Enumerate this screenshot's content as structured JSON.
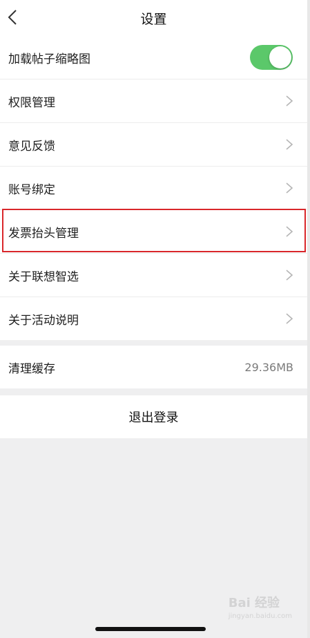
{
  "header": {
    "title": "设置"
  },
  "settings": {
    "thumbnail_label": "加载帖子缩略图",
    "thumbnail_enabled": true,
    "items": [
      {
        "label": "权限管理"
      },
      {
        "label": "意见反馈"
      },
      {
        "label": "账号绑定"
      },
      {
        "label": "发票抬头管理"
      },
      {
        "label": "关于联想智选"
      },
      {
        "label": "关于活动说明"
      }
    ]
  },
  "cache": {
    "label": "清理缓存",
    "value": "29.36MB"
  },
  "logout": {
    "label": "退出登录"
  },
  "watermark": {
    "text": "Bai 经验",
    "sub": "jingyan.baidu.com"
  },
  "colors": {
    "toggle_on": "#5bc86a",
    "highlight": "#d9262a"
  }
}
